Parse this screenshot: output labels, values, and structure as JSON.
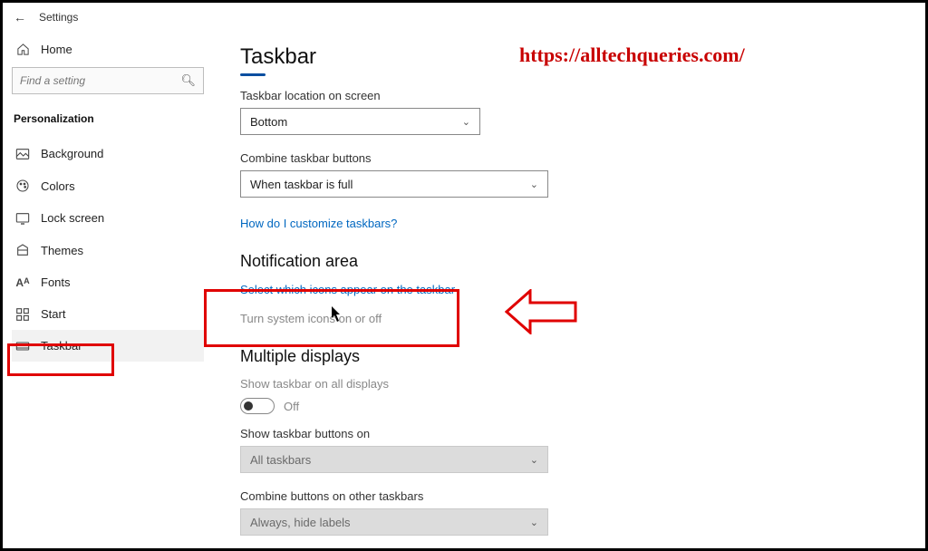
{
  "window": {
    "title": "Settings"
  },
  "sidebar": {
    "home": "Home",
    "search_placeholder": "Find a setting",
    "category": "Personalization",
    "items": [
      {
        "label": "Background"
      },
      {
        "label": "Colors"
      },
      {
        "label": "Lock screen"
      },
      {
        "label": "Themes"
      },
      {
        "label": "Fonts"
      },
      {
        "label": "Start"
      },
      {
        "label": "Taskbar"
      }
    ]
  },
  "page": {
    "title": "Taskbar",
    "location_label": "Taskbar location on screen",
    "location_value": "Bottom",
    "combine_label": "Combine taskbar buttons",
    "combine_value": "When taskbar is full",
    "customize_link": "How do I customize taskbars?",
    "notif_head": "Notification area",
    "notif_link": "Select which icons appear on the taskbar",
    "sysicons_link": "Turn system icons on or off",
    "multi_head": "Multiple displays",
    "showall_label": "Show taskbar on all displays",
    "showall_value": "Off",
    "buttons_on_label": "Show taskbar buttons on",
    "buttons_on_value": "All taskbars",
    "combine_other_label": "Combine buttons on other taskbars",
    "combine_other_value": "Always, hide labels"
  },
  "annotation": {
    "watermark": "https://alltechqueries.com/"
  }
}
